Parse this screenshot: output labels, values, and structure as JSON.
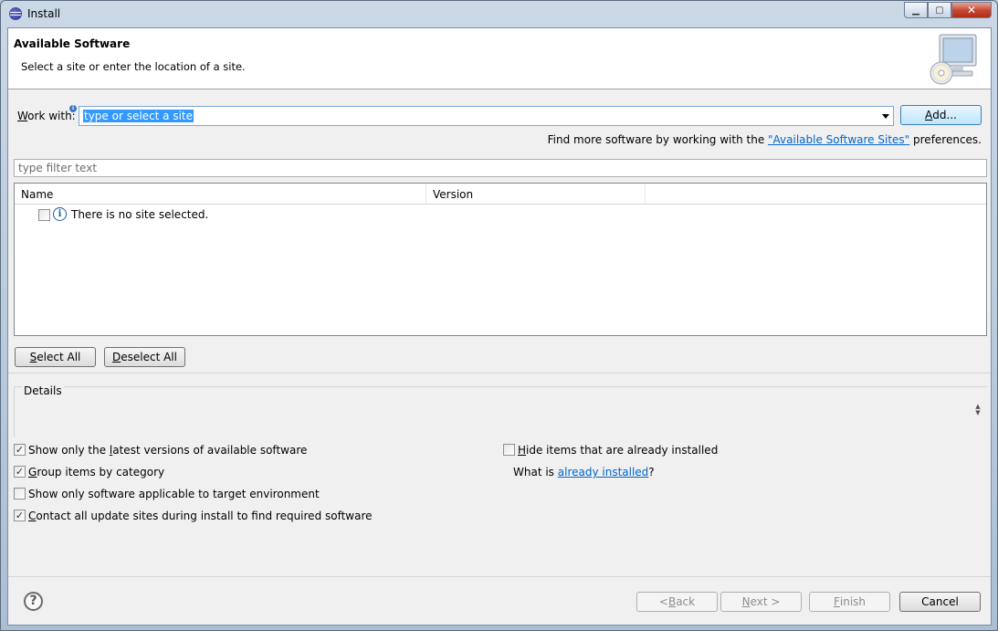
{
  "window": {
    "title": "Install",
    "controls": {
      "minimize": "▁",
      "maximize": "▢",
      "close": "✕"
    }
  },
  "header": {
    "title": "Available Software",
    "description": "Select a site or enter the location of a site."
  },
  "work_with": {
    "label_pre": "",
    "label_mnemonic": "W",
    "label_post": "ork with:",
    "value": "type or select a site",
    "add_button_mnemonic": "A",
    "add_button_post": "dd..."
  },
  "find_more": {
    "prefix": "Find more software by working with the ",
    "link": "\"Available Software Sites\"",
    "suffix": " preferences."
  },
  "filter": {
    "placeholder": "type filter text"
  },
  "tree": {
    "columns": [
      "Name",
      "Version"
    ],
    "rows": [
      {
        "checked": false,
        "text": "There is no site selected."
      }
    ]
  },
  "selection_buttons": {
    "select_all_mnemonic": "S",
    "select_all_post": "elect All",
    "deselect_all_mnemonic": "D",
    "deselect_all_post": "eselect All"
  },
  "details": {
    "label": "Details"
  },
  "options": {
    "latest_versions": {
      "checked": true,
      "pre": "Show only the ",
      "mnemonic": "l",
      "post": "atest versions of available software"
    },
    "group_by_category": {
      "checked": true,
      "pre": "",
      "mnemonic": "G",
      "post": "roup items by category"
    },
    "target_env": {
      "checked": false,
      "pre": "Show only software applicable to target environment",
      "mnemonic": "",
      "post": ""
    },
    "contact_sites": {
      "checked": true,
      "pre": "",
      "mnemonic": "C",
      "post": "ontact all update sites during install to find required software"
    },
    "hide_installed": {
      "checked": false,
      "pre": "",
      "mnemonic": "H",
      "post": "ide items that are already installed"
    }
  },
  "what_is": {
    "prefix": "What is ",
    "link": "already installed",
    "suffix": "?"
  },
  "footer": {
    "help": "?",
    "back_pre": "< ",
    "back_mnemonic": "B",
    "back_post": "ack",
    "next_pre": "",
    "next_mnemonic": "N",
    "next_post": "ext >",
    "finish_mnemonic": "F",
    "finish_post": "inish",
    "cancel": "Cancel"
  },
  "check_glyph": "✓"
}
